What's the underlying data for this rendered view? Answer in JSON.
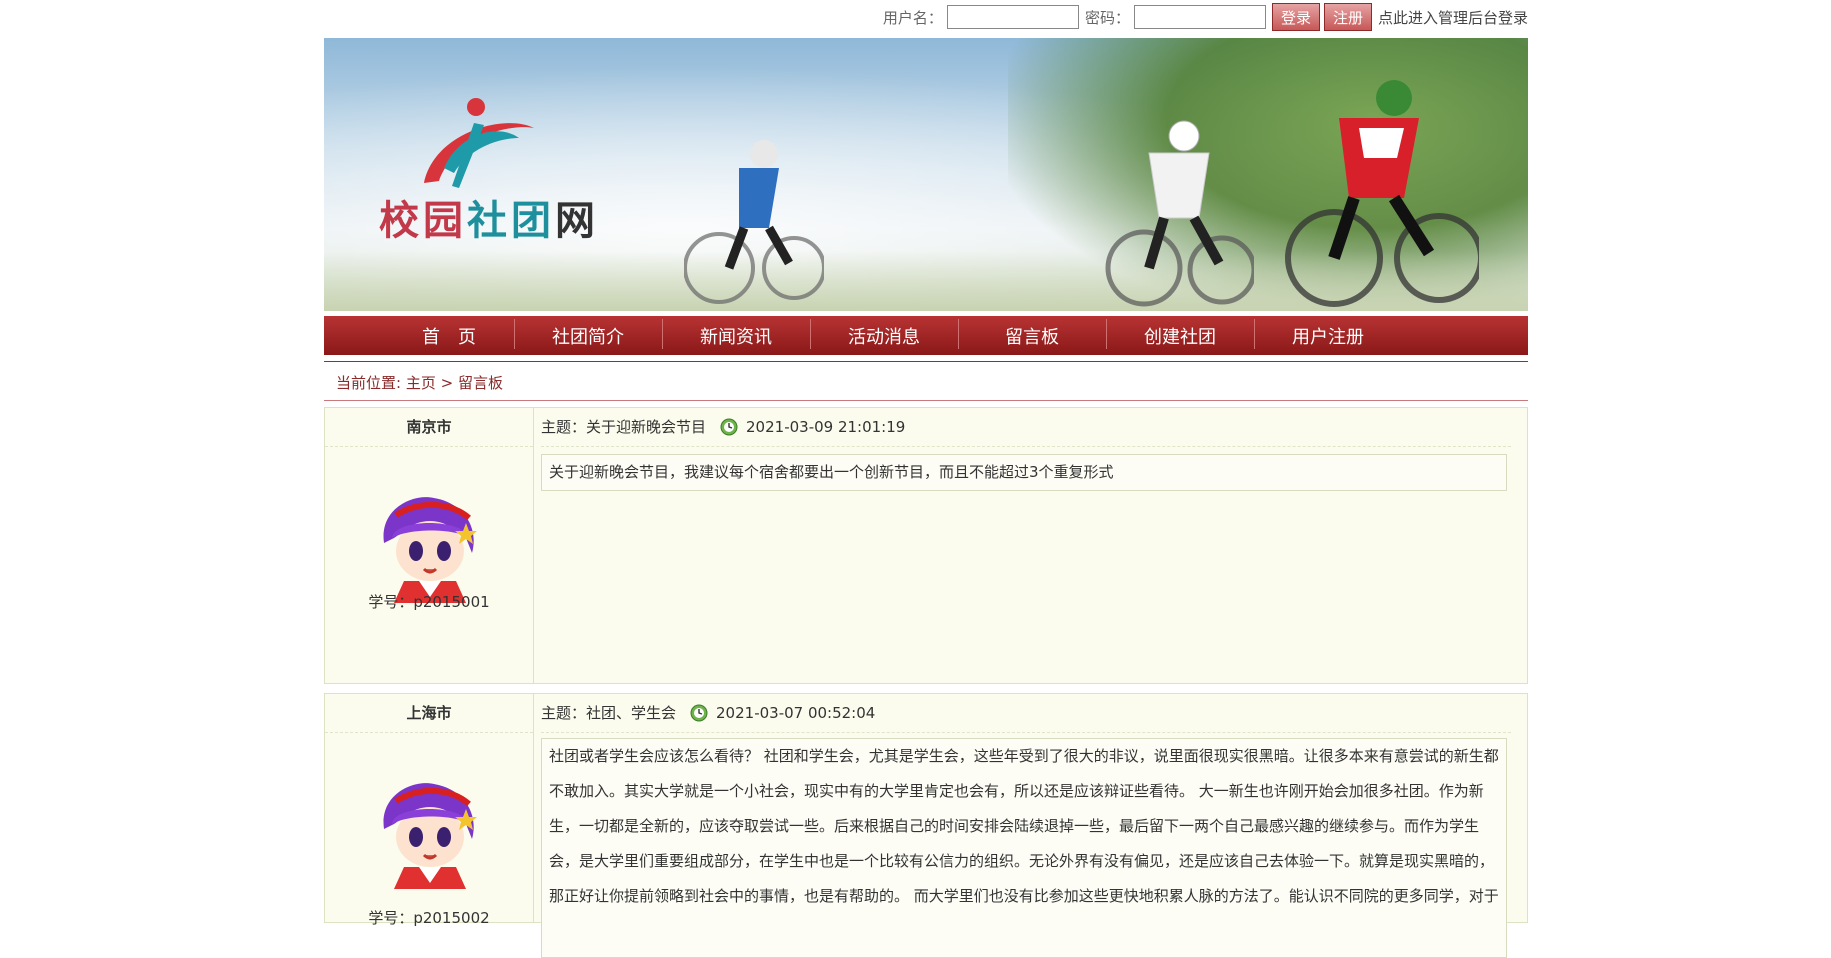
{
  "login": {
    "username_label": "用户名：",
    "username_value": "",
    "password_label": "密码：",
    "password_value": "",
    "login_button": "登录",
    "register_button": "注册",
    "admin_link": "点此进入管理后台登录"
  },
  "banner": {
    "logo_text": [
      "校",
      "园",
      "社",
      "团",
      "网"
    ]
  },
  "nav": {
    "items": [
      "首　页",
      "社团简介",
      "新闻资讯",
      "活动消息",
      "留言板",
      "创建社团",
      "用户注册"
    ]
  },
  "breadcrumb": {
    "prefix": "当前位置: ",
    "home": "主页",
    "separator": " > ",
    "current": "留言板"
  },
  "messages": [
    {
      "city": "南京市",
      "student_id": "学号：p2015001",
      "subject": "主题：关于迎新晚会节目",
      "datetime": "2021-03-09 21:01:19",
      "content": "关于迎新晚会节目，我建议每个宿舍都要出一个创新节目，而且不能超过3个重复形式"
    },
    {
      "city": "上海市",
      "student_id": "学号：p2015002",
      "subject": "主题：社团、学生会",
      "datetime": "2021-03-07 00:52:04",
      "content": "社团或者学生会应该怎么看待？ 社团和学生会，尤其是学生会，这些年受到了很大的非议，说里面很现实很黑暗。让很多本来有意尝试的新生都不敢加入。其实大学就是一个小社会，现实中有的大学里肯定也会有，所以还是应该辩证些看待。 大一新生也许刚开始会加很多社团。作为新生，一切都是全新的，应该夺取尝试一些。后来根据自己的时间安排会陆续退掉一些，最后留下一两个自己最感兴趣的继续参与。而作为学生会，是大学里们重要组成部分，在学生中也是一个比较有公信力的组织。无论外界有没有偏见，还是应该自己去体验一下。就算是现实黑暗的，那正好让你提前领略到社会中的事情，也是有帮助的。 而大学里们也没有比参加这些更快地积累人脉的方法了。能认识不同院的更多同学，对于"
    }
  ]
}
